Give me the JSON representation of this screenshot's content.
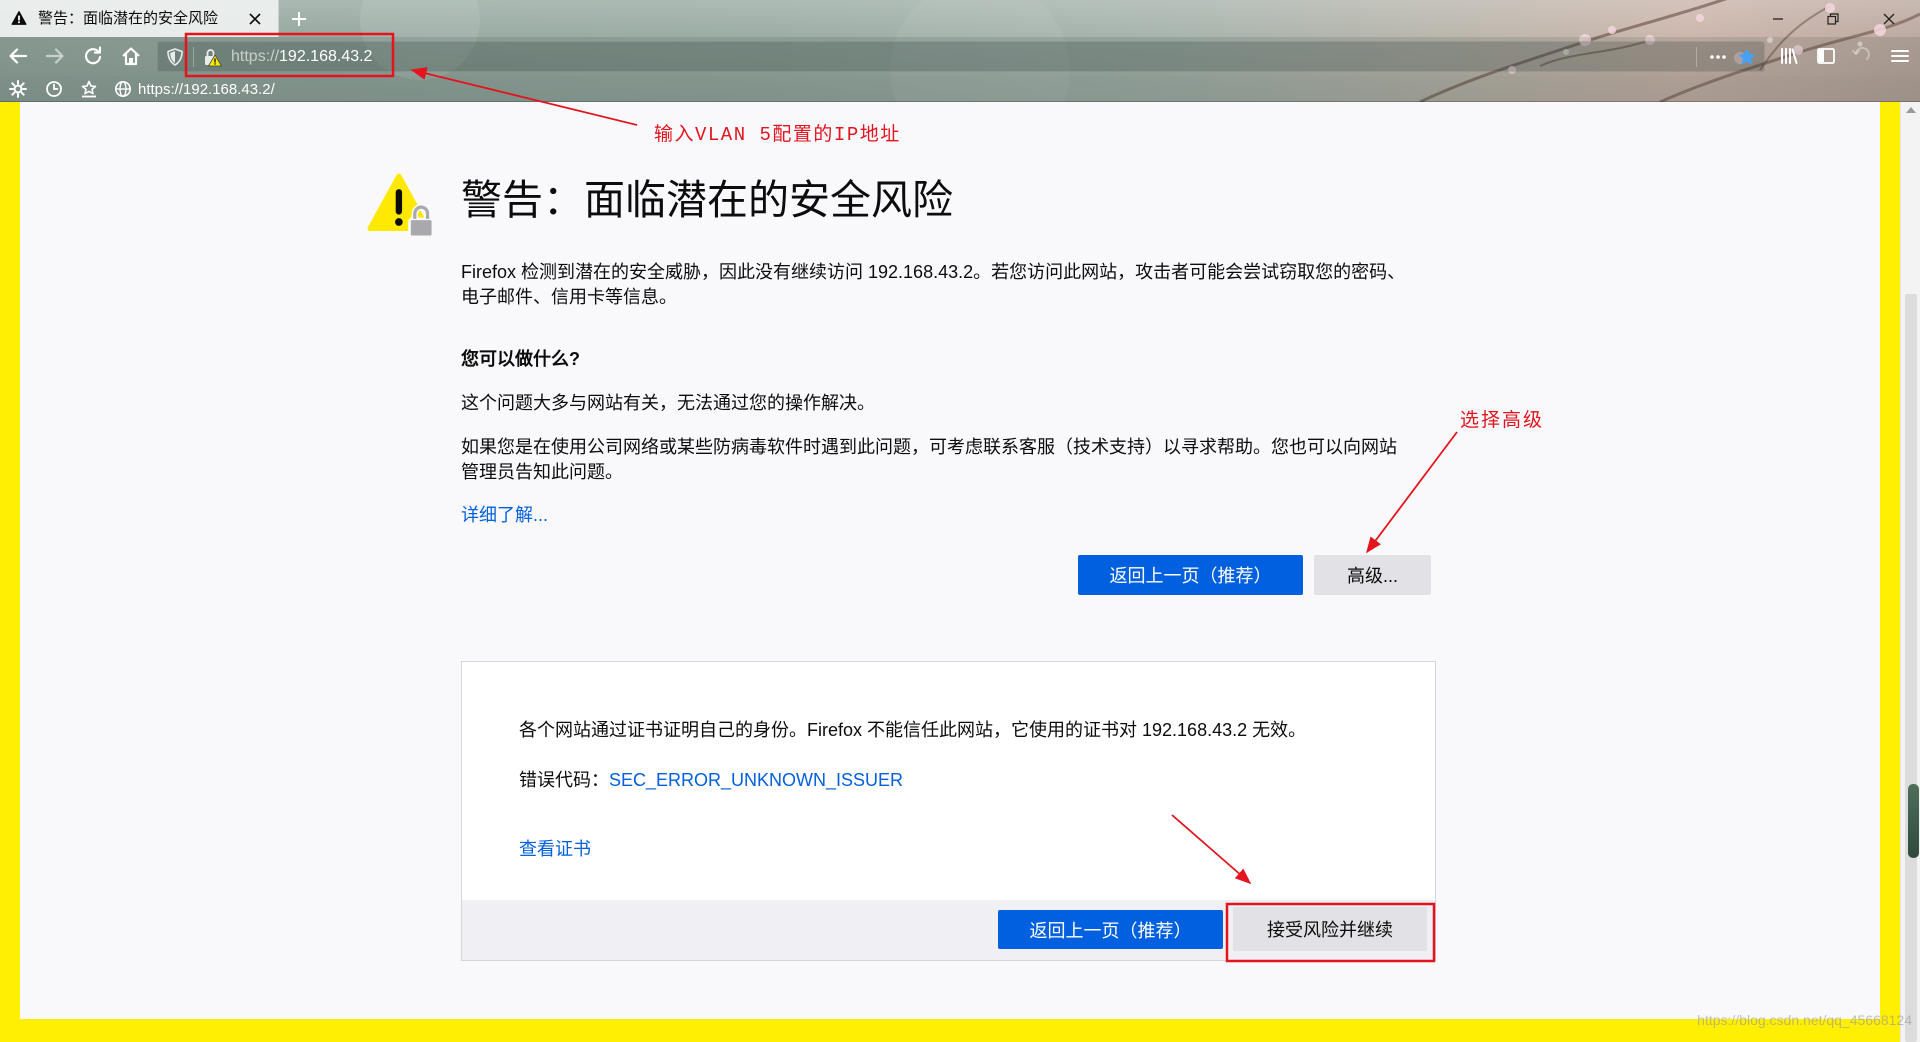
{
  "browser": {
    "tab": {
      "title": "警告：面临潜在的安全风险"
    },
    "urlbar": {
      "scheme": "https://",
      "host": "192.168.43.2"
    },
    "bookmarks": [
      {
        "label": "https://192.168.43.2/"
      }
    ]
  },
  "error_page": {
    "title": "警告：面临潜在的安全风险",
    "intro": "Firefox 检测到潜在的安全威胁，因此没有继续访问 192.168.43.2。若您访问此网站，攻击者可能会尝试窃取您的密码、电子邮件、信用卡等信息。",
    "what_heading": "您可以做什么?",
    "what_text_1": "这个问题大多与网站有关，无法通过您的操作解决。",
    "what_text_2": "如果您是在使用公司网络或某些防病毒软件时遇到此问题，可考虑联系客服（技术支持）以寻求帮助。您也可以向网站管理员告知此问题。",
    "learn_more_link": "详细了解...",
    "go_back_button": "返回上一页（推荐）",
    "advanced_button": "高级..."
  },
  "advanced_panel": {
    "description": "各个网站通过证书证明自己的身份。Firefox 不能信任此网站，它使用的证书对 192.168.43.2 无效。",
    "error_code_label": "错误代码：",
    "error_code": "SEC_ERROR_UNKNOWN_ISSUER",
    "view_certificate_link": "查看证书",
    "go_back_button": "返回上一页（推荐）",
    "accept_risk_button": "接受风险并继续"
  },
  "annotations": {
    "urlbar_note": "输入VLAN 5配置的IP地址",
    "advanced_note": "选择高级"
  },
  "watermark": "https://blog.csdn.net/qq_45668124",
  "icons": {
    "tab": "warning-icon",
    "nav": [
      "back-arrow-icon",
      "forward-arrow-icon",
      "reload-icon",
      "home-icon"
    ],
    "urlbar": [
      "tracking-shield-icon",
      "insecure-lock-icon",
      "page-actions-icon",
      "bookmark-star-icon"
    ],
    "toolbar": [
      "library-icon",
      "sidebar-icon",
      "extension-icon",
      "menu-icon"
    ],
    "bookmarks_bar": [
      "settings-gear-icon",
      "history-clock-icon",
      "bookmarks-menu-icon",
      "globe-icon"
    ],
    "page": "security-warning-icon"
  },
  "colors": {
    "accent": "#0060df",
    "highlight_frame": "#ffef00",
    "annotation": "#e3141e",
    "warning": "#ffe900"
  }
}
